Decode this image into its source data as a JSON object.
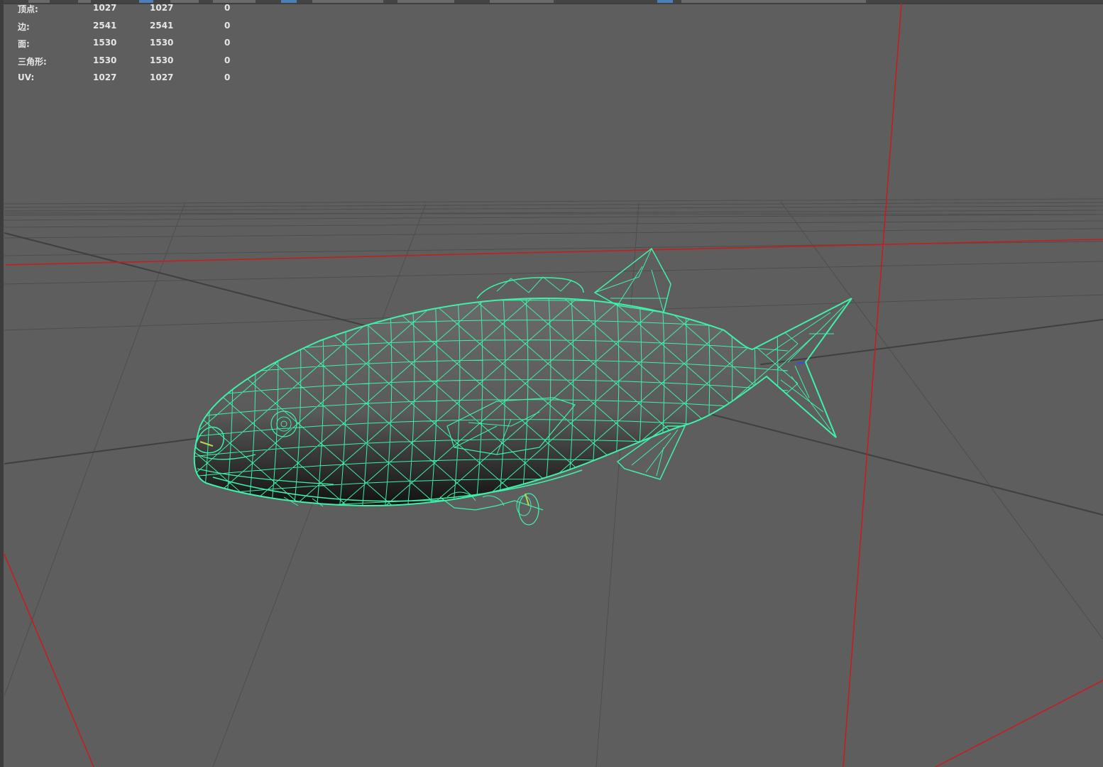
{
  "viewport": {
    "background_color": "#5e5e5e",
    "grid_color": "#4a4a4a",
    "axis_color": "#d01818",
    "wire_color": "#3ff0a8"
  },
  "hud": {
    "rows": [
      {
        "label": "顶点:",
        "values": [
          "1027",
          "1027",
          "0"
        ]
      },
      {
        "label": "边:",
        "values": [
          "2541",
          "2541",
          "0"
        ]
      },
      {
        "label": "面:",
        "values": [
          "1530",
          "1530",
          "0"
        ]
      },
      {
        "label": "三角形:",
        "values": [
          "1530",
          "1530",
          "0"
        ]
      },
      {
        "label": "UV:",
        "values": [
          "1027",
          "1027",
          "0"
        ]
      }
    ]
  },
  "model": {
    "icon": "fish-wireframe-icon"
  }
}
